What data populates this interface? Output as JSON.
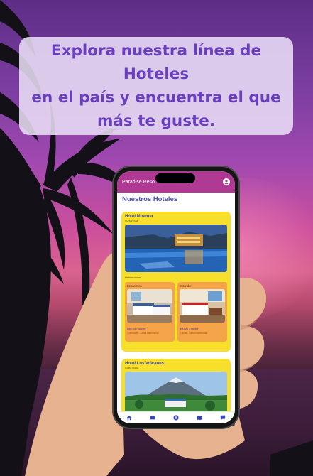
{
  "banner": {
    "line1": "Explora nuestra línea de Hoteles",
    "line2": "en el país y encuentra el que",
    "line3": "más te guste."
  },
  "app": {
    "title": "Paradise Reso",
    "page_title": "Nuestros Hoteles",
    "hotels": [
      {
        "name": "Hotel Miramar",
        "location": "Puntarenas",
        "section_label": "Habitaciones",
        "rooms": [
          {
            "type": "Economica",
            "price": "$80.00 / noche",
            "note": "2 personas - Cama matrimonial"
          },
          {
            "type": "Estandar",
            "price": "$90.00 / noche",
            "note": "2 niños - Cama matrimonial"
          }
        ]
      },
      {
        "name": "Hotel Los Volcanes",
        "location": "Costa Rica"
      }
    ],
    "nav": [
      "home-icon",
      "hotel-icon",
      "add-icon",
      "map-icon",
      "chat-icon"
    ]
  },
  "colors": {
    "appbar": "#b03a93",
    "card": "#f8df2b",
    "room_card": "#f6a44a",
    "banner_text": "#6a3fbf",
    "page_title": "#4f4fc0"
  }
}
